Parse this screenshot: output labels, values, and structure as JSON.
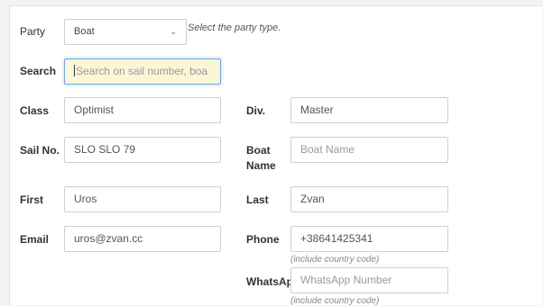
{
  "party": {
    "label": "Party",
    "selected": "Boat",
    "hint": "Select the party type."
  },
  "search": {
    "label": "Search",
    "placeholder": "Search on sail number, boa"
  },
  "class_field": {
    "label": "Class",
    "value": "Optimist"
  },
  "div_field": {
    "label": "Div.",
    "value": "Master"
  },
  "sail_no": {
    "label": "Sail No.",
    "value": "SLO SLO 79"
  },
  "boat_name": {
    "label_line1": "Boat",
    "label_line2": "Name",
    "placeholder": "Boat Name"
  },
  "first": {
    "label": "First",
    "value": "Uros"
  },
  "last": {
    "label": "Last",
    "value": "Zvan"
  },
  "email": {
    "label": "Email",
    "value": "uros@zvan.cc"
  },
  "phone": {
    "label": "Phone",
    "value": "+38641425341",
    "note": "(include country code)"
  },
  "whatsapp": {
    "label": "WhatsAp",
    "placeholder": "WhatsApp Number",
    "note": "(include country code)"
  },
  "icons": {
    "select_chevron": "chevron-down-icon"
  }
}
